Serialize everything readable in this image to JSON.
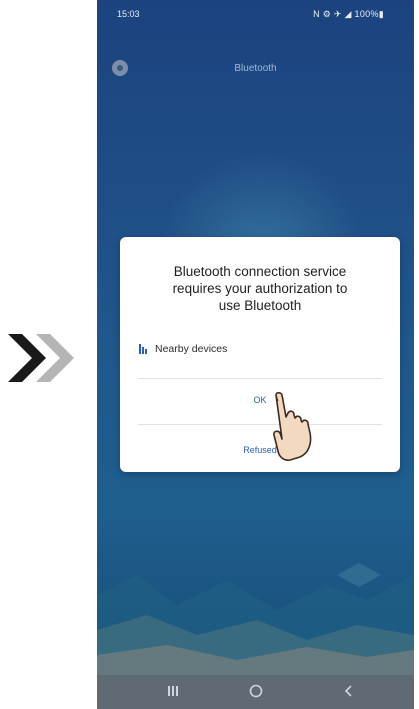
{
  "status_bar": {
    "time": "15:03",
    "icons": "N ⚙ ✈ ◢ 100%▮"
  },
  "app_bar": {
    "title": "Bluetooth",
    "settings_icon": "gear-icon"
  },
  "dialog": {
    "title_lines": [
      "Bluetooth connection service",
      "requires your authorization to",
      "use Bluetooth"
    ],
    "permission": {
      "icon": "nearby-devices-icon",
      "label": "Nearby devices"
    },
    "ok_label": "OK",
    "refuse_label": "Refused"
  },
  "nav_bar": {
    "items": [
      "recents",
      "home",
      "back"
    ]
  },
  "colors": {
    "background_top": "#1c437f",
    "background_bottom": "#1e5e8e",
    "accent": "#2c5fa8",
    "nav": "#5f6a74",
    "chevron_dark": "#1a1a1a",
    "chevron_light": "#b5b5b5"
  }
}
